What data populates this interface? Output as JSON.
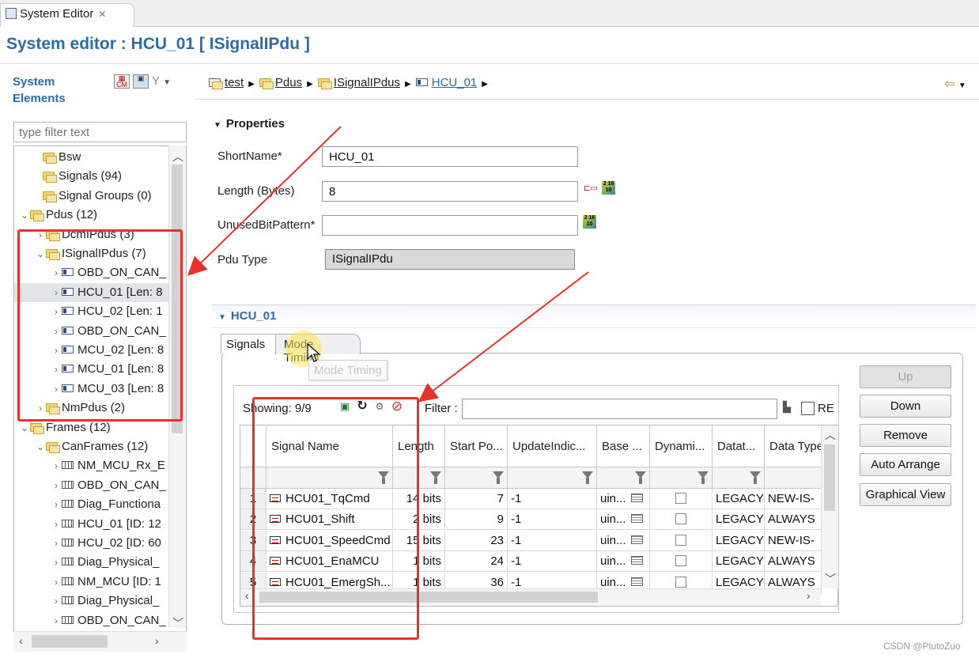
{
  "window": {
    "tab_label": "System Editor",
    "title": "System editor : HCU_01 [ ISignalIPdu ]"
  },
  "left_panel": {
    "title": "System Elements",
    "filter_placeholder": "type filter text",
    "tree": [
      {
        "label": "Bsw",
        "icon": "folder-icon",
        "toggle": ""
      },
      {
        "label": "Signals (94)",
        "icon": "folder-icon",
        "toggle": ""
      },
      {
        "label": "Signal Groups (0)",
        "icon": "folder-icon",
        "toggle": ""
      },
      {
        "label": "Pdus (12)",
        "icon": "folder-icon",
        "toggle": "v"
      },
      {
        "label": "DcmIPdus (3)",
        "icon": "folder-icon",
        "toggle": ">"
      },
      {
        "label": "ISignalIPdus (7)",
        "icon": "folder-icon",
        "toggle": "v"
      },
      {
        "label": "OBD_ON_CAN_",
        "icon": "pdu-icon",
        "toggle": ">"
      },
      {
        "label": "HCU_01 [Len: 8",
        "icon": "pdu-icon",
        "toggle": ">",
        "selected": true
      },
      {
        "label": "HCU_02 [Len: 1",
        "icon": "pdu-icon",
        "toggle": ">"
      },
      {
        "label": "OBD_ON_CAN_",
        "icon": "pdu-icon",
        "toggle": ">"
      },
      {
        "label": "MCU_02 [Len: 8",
        "icon": "pdu-icon",
        "toggle": ">"
      },
      {
        "label": "MCU_01 [Len: 8",
        "icon": "pdu-icon",
        "toggle": ">"
      },
      {
        "label": "MCU_03 [Len: 8",
        "icon": "pdu-icon",
        "toggle": ">"
      },
      {
        "label": "NmPdus (2)",
        "icon": "folder-icon",
        "toggle": ">"
      },
      {
        "label": "Frames (12)",
        "icon": "folder-icon",
        "toggle": "v"
      },
      {
        "label": "CanFrames (12)",
        "icon": "folder-icon",
        "toggle": "v"
      },
      {
        "label": "NM_MCU_Rx_E",
        "icon": "frame-icon",
        "toggle": ">"
      },
      {
        "label": "OBD_ON_CAN_",
        "icon": "frame-icon",
        "toggle": ">"
      },
      {
        "label": "Diag_Functiona",
        "icon": "frame-icon",
        "toggle": ">"
      },
      {
        "label": "HCU_01 [ID: 12",
        "icon": "frame-icon",
        "toggle": ">"
      },
      {
        "label": "HCU_02 [ID: 60",
        "icon": "frame-icon",
        "toggle": ">"
      },
      {
        "label": "Diag_Physical_",
        "icon": "frame-icon",
        "toggle": ">"
      },
      {
        "label": "NM_MCU [ID: 1",
        "icon": "frame-icon",
        "toggle": ">"
      },
      {
        "label": "Diag_Physical_",
        "icon": "frame-icon",
        "toggle": ">"
      },
      {
        "label": "OBD_ON_CAN_",
        "icon": "frame-icon",
        "toggle": ">"
      }
    ]
  },
  "breadcrumb": [
    "test",
    "Pdus",
    "ISignalIPdus",
    "HCU_01"
  ],
  "properties": {
    "header": "Properties",
    "fields": [
      {
        "label": "ShortName*",
        "value": ""
      },
      {
        "label": "Length (Bytes)",
        "value": "8"
      },
      {
        "label": "UnusedBitPattern*",
        "value": ""
      },
      {
        "label": "Pdu Type",
        "value": "ISignalIPdu"
      }
    ],
    "short_name_value": "HCU_01",
    "binary_icon_text": "2 16 10"
  },
  "section": {
    "header": "HCU_01",
    "tabs": [
      "Signals",
      "Mode Timing"
    ],
    "tooltip": "Mode Timing",
    "showing": "Showing: 9/9",
    "filter_label": "Filter :",
    "re_label": "RE"
  },
  "grid": {
    "columns": [
      "Signal Name",
      "Length",
      "Start Po...",
      "UpdateIndic...",
      "Base ...",
      "Dynami...",
      "Datat...",
      "Data Type"
    ],
    "rows": [
      {
        "no": "1",
        "name": "HCU01_TqCmd",
        "length": "14 bits",
        "start": "7",
        "update": "-1",
        "base": "uin...",
        "datat": "LEGACY",
        "dtype": "NEW-IS-"
      },
      {
        "no": "2",
        "name": "HCU01_Shift",
        "length": "2 bits",
        "start": "9",
        "update": "-1",
        "base": "uin...",
        "datat": "LEGACY",
        "dtype": "ALWAYS"
      },
      {
        "no": "3",
        "name": "HCU01_SpeedCmd",
        "length": "15 bits",
        "start": "23",
        "update": "-1",
        "base": "uin...",
        "datat": "LEGACY",
        "dtype": "NEW-IS-"
      },
      {
        "no": "4",
        "name": "HCU01_EnaMCU",
        "length": "1 bits",
        "start": "24",
        "update": "-1",
        "base": "uin...",
        "datat": "LEGACY",
        "dtype": "ALWAYS"
      },
      {
        "no": "5",
        "name": "HCU01_EmergSh...",
        "length": "1 bits",
        "start": "36",
        "update": "-1",
        "base": "uin...",
        "datat": "LEGACY",
        "dtype": "ALWAYS"
      }
    ]
  },
  "buttons": {
    "up": "Up",
    "down": "Down",
    "remove": "Remove",
    "auto_arrange": "Auto Arrange",
    "graphical_view": "Graphical View"
  },
  "watermark": "CSDN @PlutoZuo",
  "colors": {
    "title_blue": "#2a6ea8",
    "annotation_red": "#e8312b",
    "highlight_yellow": "#fae850"
  }
}
